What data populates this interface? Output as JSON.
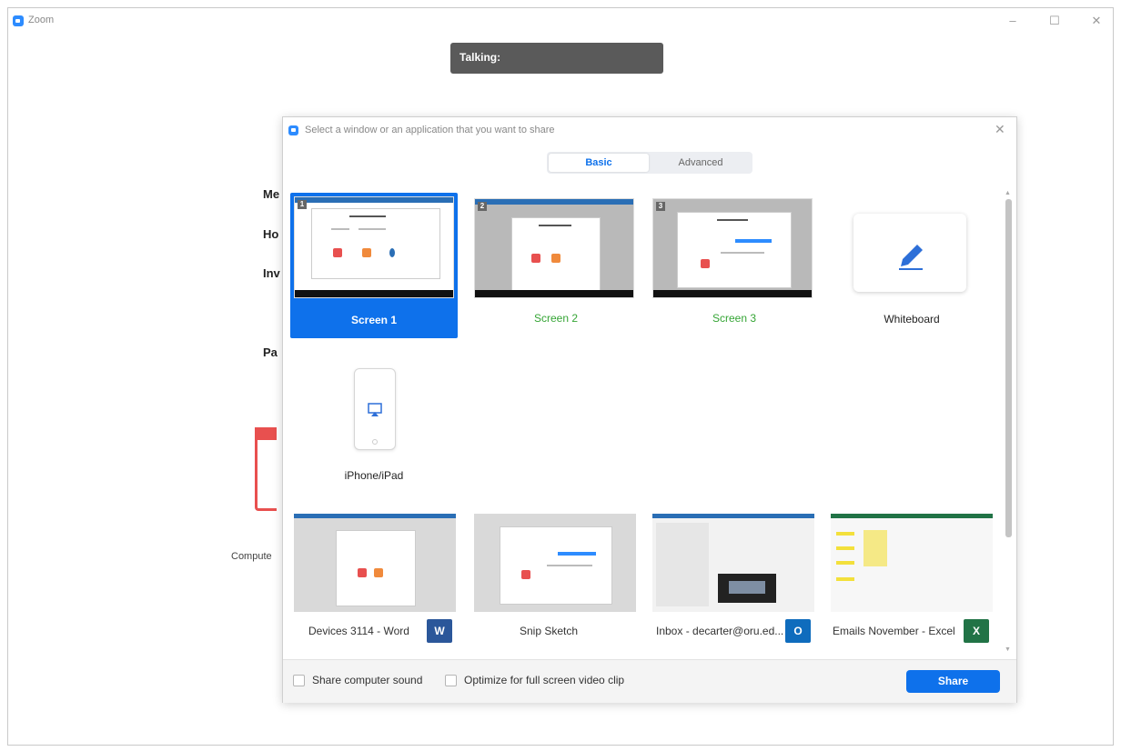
{
  "window": {
    "title": "Zoom",
    "minimize": "–",
    "maximize": "☐",
    "close": "✕"
  },
  "talking": {
    "label": "Talking:"
  },
  "background_partial": {
    "lines": [
      "Me",
      "Ho",
      "Inv",
      "Pa"
    ],
    "computer": "Compute"
  },
  "dialog": {
    "title": "Select a window or an application that you want to share",
    "close": "✕",
    "tabs": [
      {
        "label": "Basic",
        "active": true
      },
      {
        "label": "Advanced",
        "active": false
      }
    ],
    "screens": [
      {
        "label": "Screen 1",
        "number": "1",
        "selected": true
      },
      {
        "label": "Screen 2",
        "number": "2",
        "selected": false
      },
      {
        "label": "Screen 3",
        "number": "3",
        "selected": false
      }
    ],
    "whiteboard": {
      "label": "Whiteboard",
      "icon": "pencil-icon"
    },
    "iphone": {
      "label": "iPhone/iPad",
      "icon": "airplay-icon"
    },
    "apps": [
      {
        "label": "Devices 3114 - Word",
        "icon": "word-icon",
        "icon_text": "W",
        "color": "#2b579a"
      },
      {
        "label": "Snip  Sketch",
        "icon": "",
        "icon_text": "",
        "color": ""
      },
      {
        "label": "Inbox - decarter@oru.ed...",
        "icon": "outlook-icon",
        "icon_text": "O",
        "color": "#0f6cbd"
      },
      {
        "label": "Emails November - Excel",
        "icon": "excel-icon",
        "icon_text": "X",
        "color": "#217346"
      }
    ],
    "footer": {
      "share_sound": "Share computer sound",
      "optimize_video": "Optimize for full screen video clip",
      "share_button": "Share"
    }
  },
  "colors": {
    "accent": "#0e71eb",
    "selected_text": "#ffffff",
    "screen_label_green": "#35a535"
  }
}
